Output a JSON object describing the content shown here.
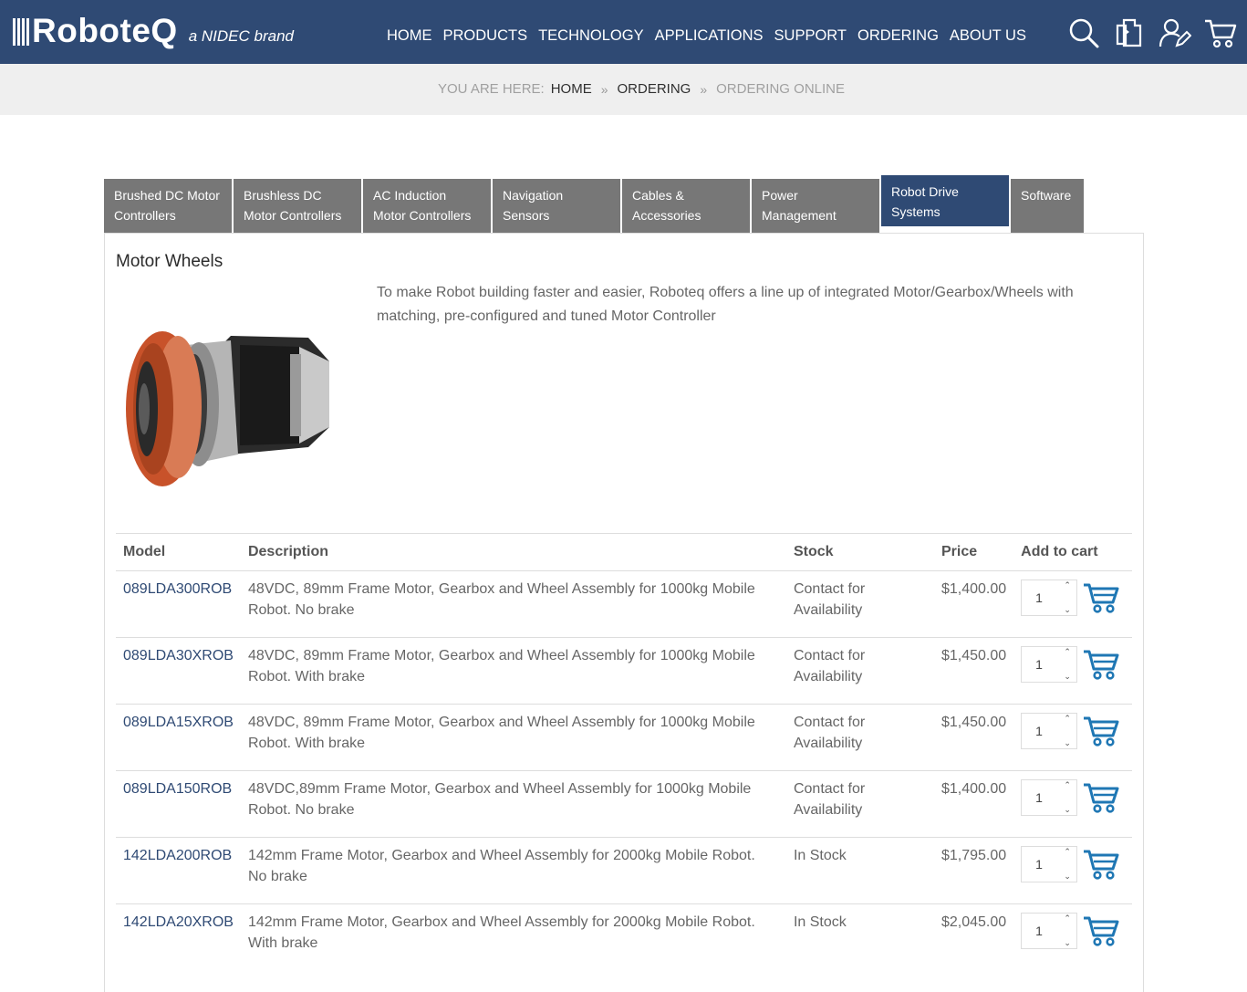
{
  "brand": {
    "name": "RoboteQ",
    "tagline": "a NIDEC brand"
  },
  "nav": {
    "items": [
      "HOME",
      "PRODUCTS",
      "TECHNOLOGY",
      "APPLICATIONS",
      "SUPPORT",
      "ORDERING",
      "ABOUT US"
    ]
  },
  "header_icons": [
    "search-icon",
    "compare-icon",
    "account-icon",
    "cart-icon"
  ],
  "breadcrumb": {
    "label": "YOU ARE HERE:",
    "items": [
      "HOME",
      "ORDERING"
    ],
    "current": "ORDERING ONLINE"
  },
  "tabs": [
    {
      "label": "Brushed DC Motor Controllers",
      "active": false
    },
    {
      "label": "Brushless DC Motor Controllers",
      "active": false
    },
    {
      "label": "AC Induction Motor Controllers",
      "active": false
    },
    {
      "label": "Navigation Sensors",
      "active": false
    },
    {
      "label": "Cables & Accessories",
      "active": false
    },
    {
      "label": "Power Management",
      "active": false
    },
    {
      "label": "Robot Drive Systems",
      "active": true
    },
    {
      "label": "Software",
      "active": false
    }
  ],
  "category": {
    "title": "Motor Wheels",
    "intro": "To make Robot building faster and easier, Roboteq offers a line up of integrated Motor/Gearbox/Wheels with matching, pre-configured and tuned Motor Controller"
  },
  "table": {
    "headers": [
      "Model",
      "Description",
      "Stock",
      "Price",
      "Add to cart"
    ],
    "rows": [
      {
        "model": "089LDA300ROB",
        "description": "48VDC, 89mm Frame Motor, Gearbox and Wheel Assembly for 1000kg Mobile Robot. No brake",
        "stock": "Contact for Availability",
        "price": "$1,400.00",
        "qty": "1"
      },
      {
        "model": "089LDA30XROB",
        "description": "48VDC, 89mm Frame Motor, Gearbox and Wheel Assembly for 1000kg Mobile Robot. With brake",
        "stock": "Contact for Availability",
        "price": "$1,450.00",
        "qty": "1"
      },
      {
        "model": "089LDA15XROB",
        "description": "48VDC, 89mm Frame Motor, Gearbox and Wheel Assembly for 1000kg Mobile Robot. With brake",
        "stock": "Contact for Availability",
        "price": "$1,450.00",
        "qty": "1"
      },
      {
        "model": "089LDA150ROB",
        "description": "48VDC,89mm Frame Motor, Gearbox and Wheel Assembly for 1000kg Mobile Robot. No brake",
        "stock": "Contact for Availability",
        "price": "$1,400.00",
        "qty": "1"
      },
      {
        "model": "142LDA200ROB",
        "description": "142mm Frame Motor, Gearbox and Wheel Assembly for 2000kg Mobile Robot. No brake",
        "stock": "In Stock",
        "price": "$1,795.00",
        "qty": "1"
      },
      {
        "model": "142LDA20XROB",
        "description": "142mm Frame Motor, Gearbox and Wheel Assembly for 2000kg Mobile Robot. With brake",
        "stock": "In Stock",
        "price": "$2,045.00",
        "qty": "1"
      }
    ]
  },
  "colors": {
    "header": "#2f4a74",
    "tab": "#777777",
    "tab_active": "#2f4a74",
    "link": "#2f4a74",
    "cart_icon": "#1f77b4"
  }
}
